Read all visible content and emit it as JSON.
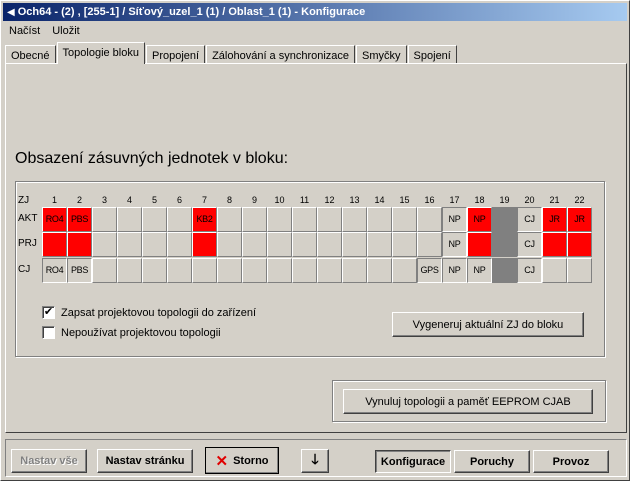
{
  "window": {
    "title": "Och64 - (2) , [255-1] / Síťový_uzel_1 (1) / Oblast_1 (1) - Konfigurace"
  },
  "menu": {
    "load": "Načíst",
    "save": "Uložit"
  },
  "tabs": [
    {
      "label": "Obecné"
    },
    {
      "label": "Topologie bloku"
    },
    {
      "label": "Propojení"
    },
    {
      "label": "Zálohování a synchronizace"
    },
    {
      "label": "Smyčky"
    },
    {
      "label": "Spojení"
    }
  ],
  "content": {
    "heading": "Obsazení zásuvných jednotek v bloku:",
    "row_labels": {
      "zj": "ZJ",
      "akt": "AKT",
      "prj": "PRJ",
      "cj": "CJ"
    },
    "columns": [
      "1",
      "2",
      "3",
      "4",
      "5",
      "6",
      "7",
      "8",
      "9",
      "10",
      "11",
      "12",
      "13",
      "14",
      "15",
      "16",
      "17",
      "18",
      "19",
      "20",
      "21",
      "22"
    ],
    "akt": [
      {
        "text": "RO4",
        "state": "red"
      },
      {
        "text": "PBS",
        "state": "red"
      },
      {
        "text": "",
        "state": "empty"
      },
      {
        "text": "",
        "state": "empty"
      },
      {
        "text": "",
        "state": "empty"
      },
      {
        "text": "",
        "state": "empty"
      },
      {
        "text": "KB2",
        "state": "red"
      },
      {
        "text": "",
        "state": "empty"
      },
      {
        "text": "",
        "state": "empty"
      },
      {
        "text": "",
        "state": "empty"
      },
      {
        "text": "",
        "state": "empty"
      },
      {
        "text": "",
        "state": "empty"
      },
      {
        "text": "",
        "state": "empty"
      },
      {
        "text": "",
        "state": "empty"
      },
      {
        "text": "",
        "state": "empty"
      },
      {
        "text": "",
        "state": "empty"
      },
      {
        "text": "NP",
        "state": "white"
      },
      {
        "text": "NP",
        "state": "red"
      },
      {
        "text": "",
        "state": "gray"
      },
      {
        "text": "CJ",
        "state": "white"
      },
      {
        "text": "JR",
        "state": "red"
      },
      {
        "text": "JR",
        "state": "red"
      }
    ],
    "prj": [
      {
        "text": "",
        "state": "red"
      },
      {
        "text": "",
        "state": "red"
      },
      {
        "text": "",
        "state": "empty"
      },
      {
        "text": "",
        "state": "empty"
      },
      {
        "text": "",
        "state": "empty"
      },
      {
        "text": "",
        "state": "empty"
      },
      {
        "text": "",
        "state": "red"
      },
      {
        "text": "",
        "state": "empty"
      },
      {
        "text": "",
        "state": "empty"
      },
      {
        "text": "",
        "state": "empty"
      },
      {
        "text": "",
        "state": "empty"
      },
      {
        "text": "",
        "state": "empty"
      },
      {
        "text": "",
        "state": "empty"
      },
      {
        "text": "",
        "state": "empty"
      },
      {
        "text": "",
        "state": "empty"
      },
      {
        "text": "",
        "state": "empty"
      },
      {
        "text": "NP",
        "state": "white"
      },
      {
        "text": "",
        "state": "red"
      },
      {
        "text": "",
        "state": "gray"
      },
      {
        "text": "CJ",
        "state": "white"
      },
      {
        "text": "",
        "state": "red"
      },
      {
        "text": "",
        "state": "red"
      }
    ],
    "cj": [
      {
        "text": "RO4",
        "state": "white"
      },
      {
        "text": "PBS",
        "state": "white"
      },
      {
        "text": "",
        "state": "empty"
      },
      {
        "text": "",
        "state": "empty"
      },
      {
        "text": "",
        "state": "empty"
      },
      {
        "text": "",
        "state": "empty"
      },
      {
        "text": "",
        "state": "empty"
      },
      {
        "text": "",
        "state": "empty"
      },
      {
        "text": "",
        "state": "empty"
      },
      {
        "text": "",
        "state": "empty"
      },
      {
        "text": "",
        "state": "empty"
      },
      {
        "text": "",
        "state": "empty"
      },
      {
        "text": "",
        "state": "empty"
      },
      {
        "text": "",
        "state": "empty"
      },
      {
        "text": "",
        "state": "empty"
      },
      {
        "text": "GPS",
        "state": "white"
      },
      {
        "text": "NP",
        "state": "white"
      },
      {
        "text": "NP",
        "state": "white"
      },
      {
        "text": "",
        "state": "gray"
      },
      {
        "text": "CJ",
        "state": "white"
      },
      {
        "text": "",
        "state": "empty"
      },
      {
        "text": "",
        "state": "empty"
      }
    ],
    "checkbox_write": {
      "label": "Zapsat projektovou topologii do zařízení",
      "checked": true,
      "mark": "✔"
    },
    "checkbox_nouse": {
      "label": "Nepoužívat projektovou topologii",
      "checked": false,
      "mark": ""
    },
    "generate_button": "Vygeneruj aktuální ZJ do bloku",
    "reset_button": "Vynuluj topologii a paměť EEPROM CJAB"
  },
  "bottom": {
    "set_all": "Nastav vše",
    "set_page": "Nastav stránku",
    "storno": "Storno",
    "storno_icon": "✕",
    "down_icon": "🡓",
    "config": "Konfigurace",
    "faults": "Poruchy",
    "operation": "Provoz"
  },
  "colors": {
    "red": "#ff0000",
    "gray": "#808080",
    "face": "#d4d0c8"
  }
}
